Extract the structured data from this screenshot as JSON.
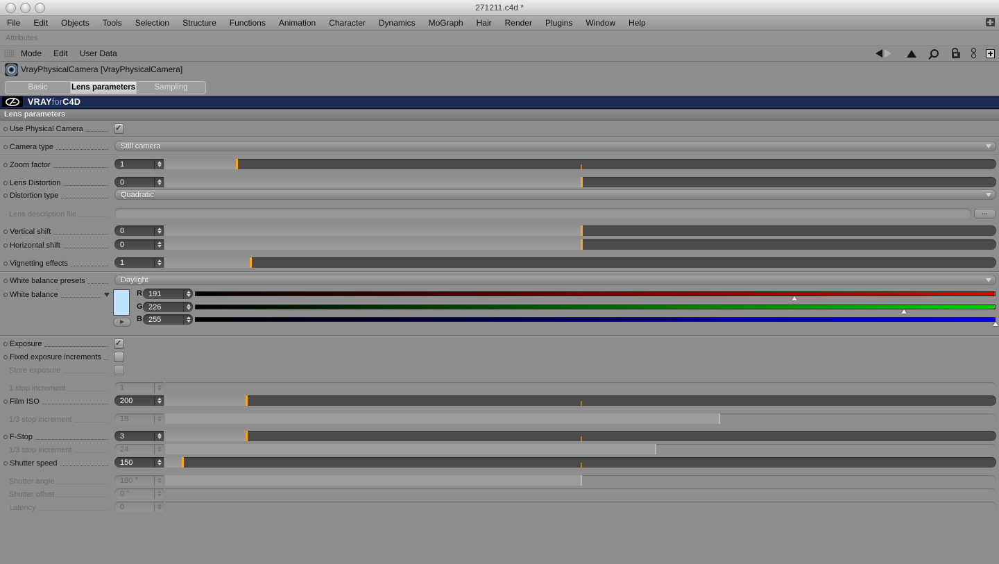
{
  "window": {
    "title": "271211.c4d *"
  },
  "menu_bar": {
    "items": [
      "File",
      "Edit",
      "Objects",
      "Tools",
      "Selection",
      "Structure",
      "Functions",
      "Animation",
      "Character",
      "Dynamics",
      "MoGraph",
      "Hair",
      "Render",
      "Plugins",
      "Window",
      "Help"
    ]
  },
  "attributes_panel": {
    "title": "Attributes",
    "menu_items": [
      "Mode",
      "Edit",
      "User Data"
    ],
    "nav_icons": [
      "back-icon",
      "forward-icon",
      "up-icon",
      "search-icon",
      "lock-icon",
      "link-icon",
      "add-panel-icon"
    ]
  },
  "object_header": {
    "label": "VrayPhysicalCamera [VrayPhysicalCamera]",
    "icon": "camera-lens-icon"
  },
  "tabs": [
    {
      "label": "Basic",
      "active": false
    },
    {
      "label": "Lens parameters",
      "active": true
    },
    {
      "label": "Sampling",
      "active": false
    }
  ],
  "brand_bar": {
    "vray": "VRAY",
    "for": "for",
    "c4d": "C4D",
    "logo_icon": "vray-c4d-logo"
  },
  "section": {
    "title": "Lens parameters"
  },
  "glyphs": {
    "check": "✓",
    "ellipsis": "..."
  },
  "colors": {
    "accent_orange": "#f5a623",
    "swatch_blue": "#bfe2ff",
    "brand_navy": "#1c2a54",
    "red_channel": "#e10000",
    "green_channel": "#00ce00",
    "blue_channel": "#0000e0"
  },
  "rows": [
    {
      "kind": "checkbox",
      "name": "use-physical-camera",
      "label": "Use Physical Camera",
      "checked": true,
      "enabled": true
    },
    {
      "kind": "separator"
    },
    {
      "kind": "dropdown",
      "name": "camera-type",
      "label": "Camera type",
      "value": "Still camera",
      "enabled": true
    },
    {
      "kind": "separator"
    },
    {
      "kind": "slider",
      "name": "zoom-factor",
      "label": "Zoom factor",
      "value": "1",
      "pos": 0.086,
      "minor": 0.501,
      "enabled": true
    },
    {
      "kind": "slider",
      "name": "lens-distortion",
      "label": "Lens Distortion",
      "value": "0",
      "pos": 0.501,
      "minor": null,
      "enabled": true
    },
    {
      "kind": "dropdown",
      "name": "distortion-type",
      "label": "Distortion type",
      "value": "Quadratic",
      "enabled": true
    },
    {
      "kind": "filefield",
      "name": "lens-description-file",
      "label": "Lens description file",
      "value": "",
      "button": "...",
      "enabled": false
    },
    {
      "kind": "slider",
      "name": "vertical-shift",
      "label": "Vertical shift",
      "value": "0",
      "pos": 0.501,
      "minor": null,
      "enabled": true
    },
    {
      "kind": "slider",
      "name": "horizontal-shift",
      "label": "Horizontal shift",
      "value": "0",
      "pos": 0.501,
      "minor": null,
      "enabled": true
    },
    {
      "kind": "slider",
      "name": "vignetting-effects",
      "label": "Vignetting effects",
      "value": "1",
      "pos": 0.103,
      "minor": null,
      "enabled": true
    },
    {
      "kind": "separator"
    },
    {
      "kind": "dropdown",
      "name": "white-balance-presets",
      "label": "White balance presets",
      "value": "Daylight",
      "enabled": true
    },
    {
      "kind": "colorgroup",
      "name": "white-balance",
      "label": "White balance",
      "enabled": true,
      "swatch": "#bfe2ff",
      "channels": [
        {
          "letter": "R",
          "value": "191",
          "color": "#e10000",
          "pos": 0.749
        },
        {
          "letter": "G",
          "value": "226",
          "color": "#00ce00",
          "pos": 0.886
        },
        {
          "letter": "B",
          "value": "255",
          "color": "#0000e0",
          "pos": 1.0
        }
      ]
    },
    {
      "kind": "separator"
    },
    {
      "kind": "checkbox",
      "name": "exposure",
      "label": "Exposure",
      "checked": true,
      "enabled": true
    },
    {
      "kind": "checkbox",
      "name": "fixed-exposure-increments",
      "label": "Fixed exposure increments",
      "checked": false,
      "enabled": true
    },
    {
      "kind": "checkbox",
      "name": "store-exposure",
      "label": "Store exposure",
      "checked": false,
      "enabled": false
    },
    {
      "kind": "slider",
      "name": "one-stop-increment",
      "label": "1 stop increment",
      "value": "1",
      "pos": null,
      "minor": null,
      "enabled": false
    },
    {
      "kind": "slider",
      "name": "film-iso",
      "label": "Film ISO",
      "value": "200",
      "pos": 0.098,
      "minor": 0.501,
      "enabled": true
    },
    {
      "kind": "slider",
      "name": "one-third-stop-increment-iso",
      "label": "1/3 stop increment",
      "value": "18",
      "pos": 0.667,
      "minor": null,
      "enabled": false
    },
    {
      "kind": "slider",
      "name": "f-stop",
      "label": "F-Stop",
      "value": "3",
      "pos": 0.098,
      "minor": 0.501,
      "enabled": true
    },
    {
      "kind": "slider",
      "name": "one-third-stop-increment-fstop",
      "label": "1/3 stop increment",
      "value": "24",
      "pos": 0.59,
      "minor": null,
      "enabled": false
    },
    {
      "kind": "slider",
      "name": "shutter-speed",
      "label": "Shutter speed",
      "value": "150",
      "pos": 0.021,
      "minor": 0.501,
      "enabled": true
    },
    {
      "kind": "slider",
      "name": "shutter-angle",
      "label": "Shutter angle",
      "value": "180 °",
      "pos": 0.501,
      "minor": null,
      "enabled": false
    },
    {
      "kind": "slider",
      "name": "shutter-offset",
      "label": "Shutter offset",
      "value": "0 °",
      "pos": null,
      "minor": null,
      "enabled": false
    },
    {
      "kind": "slider",
      "name": "latency",
      "label": "Latency",
      "value": "0",
      "pos": null,
      "minor": null,
      "enabled": false
    }
  ]
}
